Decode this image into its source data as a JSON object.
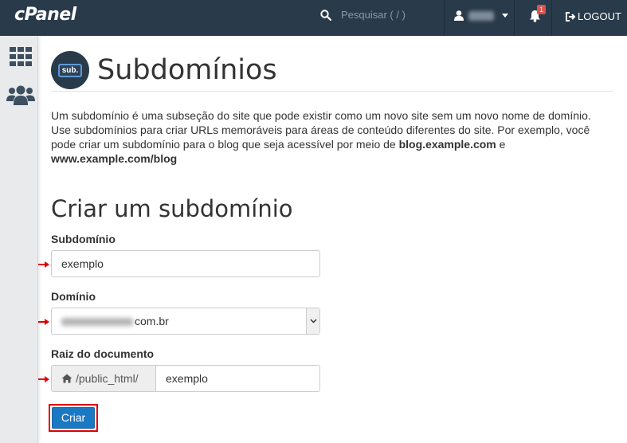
{
  "header": {
    "logo": "cPanel",
    "search_placeholder": "Pesquisar ( / )",
    "notification_count": "1",
    "logout_label": "LOGOUT"
  },
  "page": {
    "title": "Subdomínios",
    "icon_text": "sub.",
    "description_1": "Um subdomínio é uma subseção do site que pode existir como um novo site sem um novo nome de domínio. Use subdomínios para criar URLs memoráveis para áreas de conteúdo diferentes do site. Por exemplo, você pode criar um subdomínio para o blog que seja acessível por meio de ",
    "description_bold_1": "blog.example.com",
    "description_2": " e ",
    "description_bold_2": "www.example.com/blog"
  },
  "form": {
    "section_title": "Criar um subdomínio",
    "subdomain_label": "Subdomínio",
    "subdomain_value": "exemplo",
    "domain_label": "Domínio",
    "domain_value_suffix": "com.br",
    "docroot_label": "Raiz do documento",
    "docroot_prefix": "/public_html/",
    "docroot_value": "exemplo",
    "submit_label": "Criar"
  },
  "colors": {
    "topbar": "#293a4a",
    "primary_button": "#1b78c3",
    "highlight": "#e00000"
  }
}
